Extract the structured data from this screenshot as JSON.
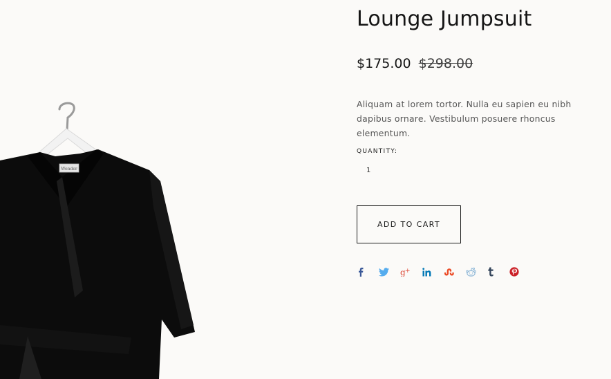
{
  "product": {
    "title": "Lounge Jumpsuit",
    "price_sale": "$175.00",
    "price_original": "$298.00",
    "description": "Aliquam at lorem tortor. Nulla eu sapien eu nibh dapibus ornare. Vestibulum posuere rhoncus elementum.",
    "tag_text": "Wonder"
  },
  "quantity": {
    "label": "QUANTITY:",
    "value": "1"
  },
  "cart": {
    "button_label": "ADD TO CART"
  },
  "share": [
    {
      "icon": "facebook-icon",
      "color": "#3b5998"
    },
    {
      "icon": "twitter-icon",
      "color": "#55acee"
    },
    {
      "icon": "google-plus-icon",
      "color": "#dd4b39"
    },
    {
      "icon": "linkedin-icon",
      "color": "#0077b5"
    },
    {
      "icon": "stumbleupon-icon",
      "color": "#eb4924"
    },
    {
      "icon": "reddit-icon",
      "color": "#8fb8d8"
    },
    {
      "icon": "tumblr-icon",
      "color": "#35465c"
    },
    {
      "icon": "pinterest-icon",
      "color": "#cb2027"
    }
  ]
}
